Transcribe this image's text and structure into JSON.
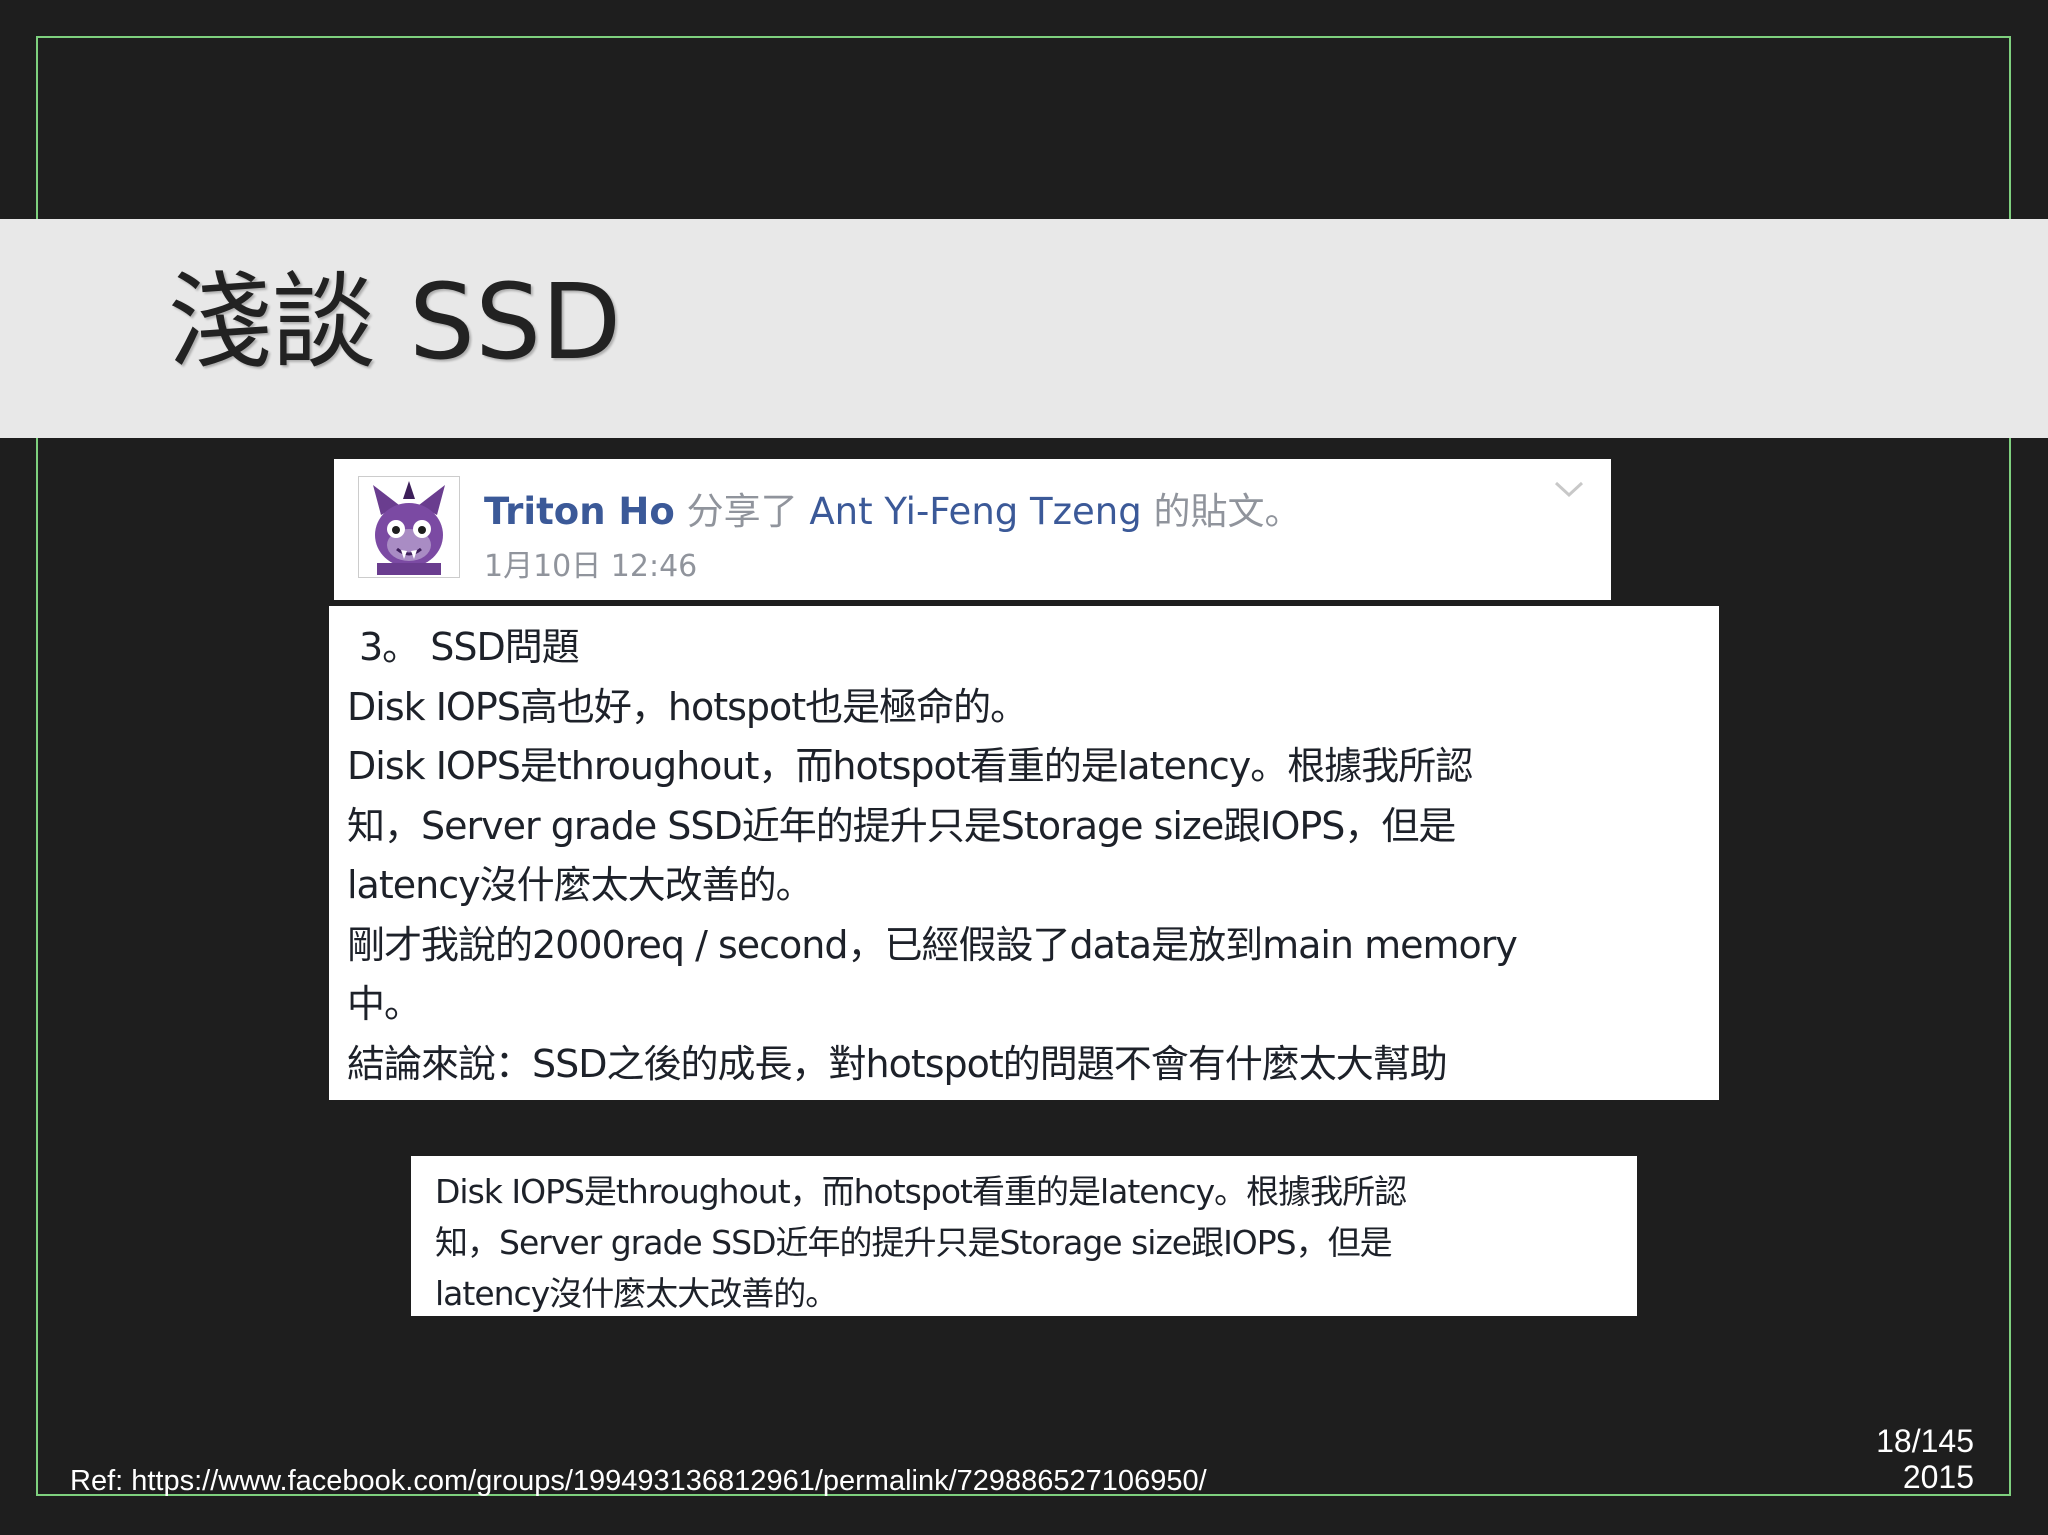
{
  "slide": {
    "title": "淺談 SSD",
    "page_number": "18/145",
    "year": "2015",
    "reference": "Ref: https://www.facebook.com/groups/199493136812961/permalink/729886527106950/"
  },
  "fb_card": {
    "author": "Triton Ho",
    "verb": "分享了",
    "original_author": "Ant Yi-Feng Tzeng",
    "suffix": "的貼文。",
    "date": "1月10日 12:46",
    "avatar_icon": "purple-cat-avatar-icon",
    "menu_icon": "chevron-down-icon"
  },
  "post": {
    "heading": "3。    SSD問題",
    "lines": [
      "Disk IOPS高也好，hotspot也是極命的。",
      "Disk IOPS是throughout，而hotspot看重的是latency。根據我所認",
      "知，Server grade SSD近年的提升只是Storage size跟IOPS，但是",
      "latency沒什麼太大改善的。",
      "剛才我說的2000req / second，已經假設了data是放到main memory",
      "中。",
      "結論來說：SSD之後的成長，對hotspot的問題不會有什麼太大幫助"
    ]
  },
  "quote": {
    "lines": [
      "Disk IOPS是throughout，而hotspot看重的是latency。根據我所認",
      "知，Server grade SSD近年的提升只是Storage size跟IOPS，但是",
      "latency沒什麼太大改善的。"
    ]
  },
  "colors": {
    "background": "#1e1e1e",
    "title_band": "#e8e8e8",
    "frame": "#7ed07e",
    "fb_link": "#3b5998",
    "fb_meta": "#90949c"
  }
}
